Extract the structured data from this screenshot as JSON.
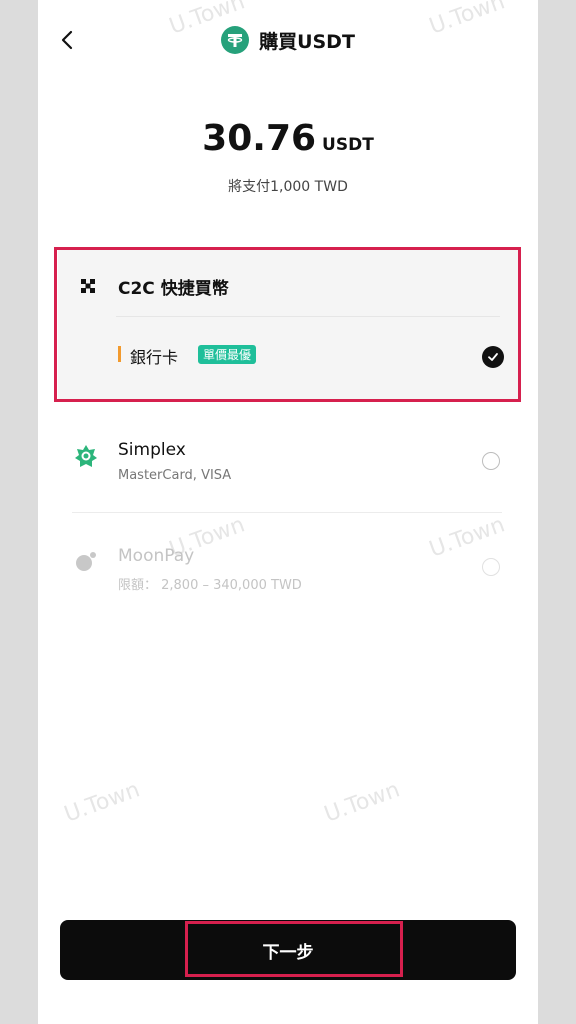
{
  "header": {
    "title": "購買USDT",
    "back_icon": "chevron-left-icon",
    "token_icon": "tether-icon"
  },
  "amount": {
    "value": "30.76",
    "currency": "USDT",
    "pay_text": "將支付1,000 TWD"
  },
  "c2c": {
    "title": "C2C 快捷買幣",
    "method_label": "銀行卡",
    "badge": "單價最優",
    "selected": true
  },
  "options": [
    {
      "name": "Simplex",
      "sub": "MasterCard, VISA",
      "icon": "simplex-icon",
      "enabled": true
    },
    {
      "name": "MoonPay",
      "sub": "限額： 2,800 – 340,000 TWD",
      "icon": "moonpay-icon",
      "enabled": false
    }
  ],
  "watermark": "U.Town",
  "footer": {
    "next_label": "下一步"
  },
  "colors": {
    "tether": "#26a17b",
    "badge": "#1fbf9a",
    "highlight": "#d6204e",
    "accent_bar": "#f29a2e",
    "button": "#0c0c0c"
  }
}
